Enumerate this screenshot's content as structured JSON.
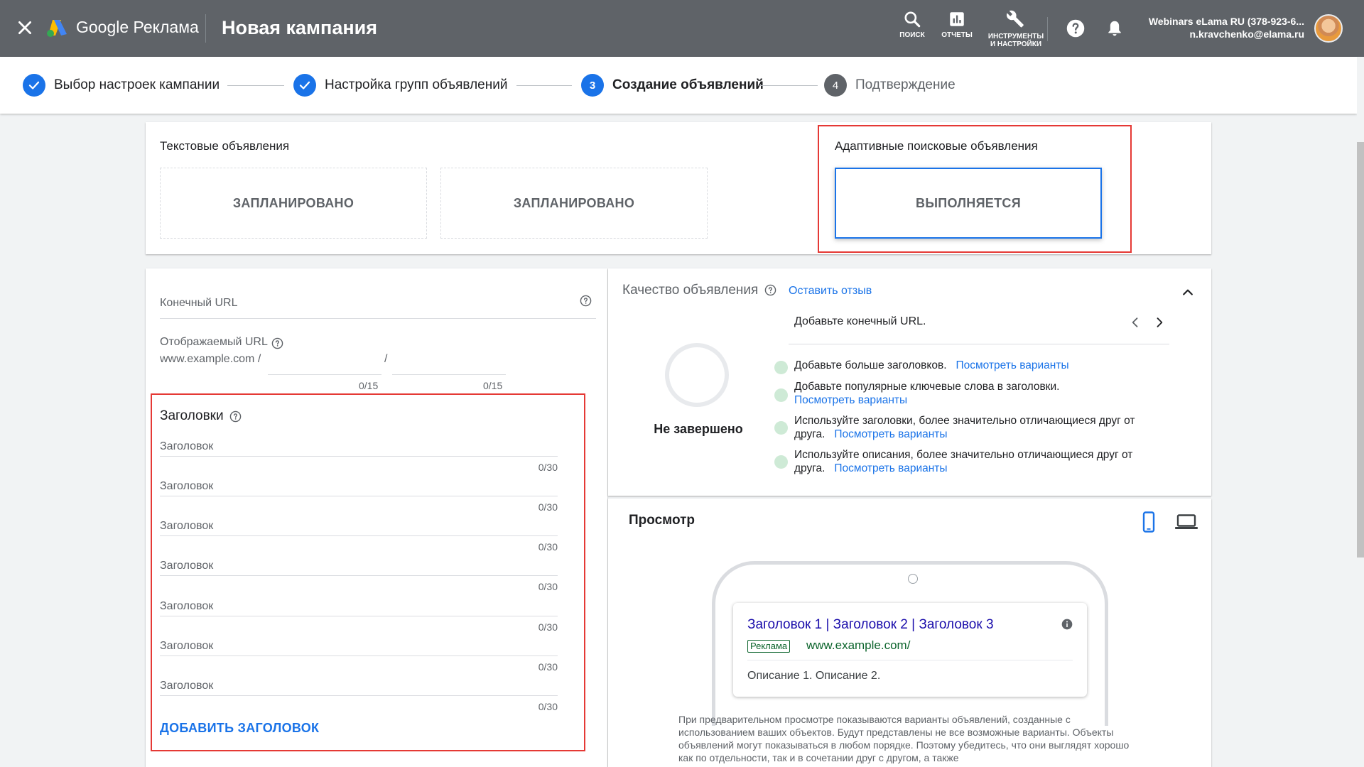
{
  "topbar": {
    "brand": "Google Реклама",
    "campaign_title": "Новая кампания",
    "search_label": "ПОИСК",
    "reports_label": "ОТЧЕТЫ",
    "tools_label_line1": "ИНСТРУМЕНТЫ",
    "tools_label_line2": "И НАСТРОЙКИ",
    "account_name": "Webinars eLama RU (378-923-6...",
    "account_email": "n.kravchenko@elama.ru"
  },
  "steps": [
    {
      "number": "1",
      "label": "Выбор настроек кампании",
      "state": "done"
    },
    {
      "number": "2",
      "label": "Настройка групп объявлений",
      "state": "done"
    },
    {
      "number": "3",
      "label": "Создание объявлений",
      "state": "active"
    },
    {
      "number": "4",
      "label": "Подтверждение",
      "state": "todo"
    }
  ],
  "ad_types": {
    "text_ads_label": "Текстовые объявления",
    "box1_status": "ЗАПЛАНИРОВАНО",
    "box2_status": "ЗАПЛАНИРОВАНО",
    "responsive_label": "Адаптивные поисковые объявления",
    "box3_status": "ВЫПОЛНЯЕТСЯ"
  },
  "form": {
    "final_url_label": "Конечный URL",
    "display_url_label": "Отображаемый URL",
    "display_url_base": "www.example.com /",
    "path_separator": "/",
    "path1_counter": "0/15",
    "path2_counter": "0/15",
    "headlines_title": "Заголовки",
    "headlines": [
      {
        "placeholder": "Заголовок",
        "counter": "0/30"
      },
      {
        "placeholder": "Заголовок",
        "counter": "0/30"
      },
      {
        "placeholder": "Заголовок",
        "counter": "0/30"
      },
      {
        "placeholder": "Заголовок",
        "counter": "0/30"
      },
      {
        "placeholder": "Заголовок",
        "counter": "0/30"
      },
      {
        "placeholder": "Заголовок",
        "counter": "0/30"
      },
      {
        "placeholder": "Заголовок",
        "counter": "0/30"
      }
    ],
    "add_headline": "ДОБАВИТЬ ЗАГОЛОВОК"
  },
  "quality": {
    "title": "Качество объявления",
    "feedback_link": "Оставить отзыв",
    "message": "Добавьте конечный URL.",
    "status": "Не завершено",
    "items": [
      {
        "text": "Добавьте больше заголовков.",
        "link": "Посмотреть варианты"
      },
      {
        "text": "Добавьте популярные ключевые слова в заголовки.",
        "link": "Посмотреть варианты"
      },
      {
        "text": "Используйте заголовки, более значительно отличающиеся друг от друга.",
        "link": "Посмотреть варианты"
      },
      {
        "text": "Используйте описания, более значительно отличающиеся друг от друга.",
        "link": "Посмотреть варианты"
      }
    ]
  },
  "preview": {
    "title": "Просмотр",
    "ad_headline": "Заголовок 1 | Заголовок 2 | Заголовок 3",
    "ad_badge": "Реклама",
    "ad_url": "www.example.com/",
    "ad_description": "Описание 1. Описание 2.",
    "note": "При предварительном просмотре показываются варианты объявлений, созданные с использованием ваших объектов. Будут представлены не все возможные варианты. Объекты объявлений могут показываться в любом порядке. Поэтому убедитесь, что они выглядят хорошо как по отдельности, так и в сочетании друг с другом, а также"
  },
  "colors": {
    "topbar": "#5f6368",
    "accent": "#1a73e8",
    "highlight": "#e53935"
  }
}
